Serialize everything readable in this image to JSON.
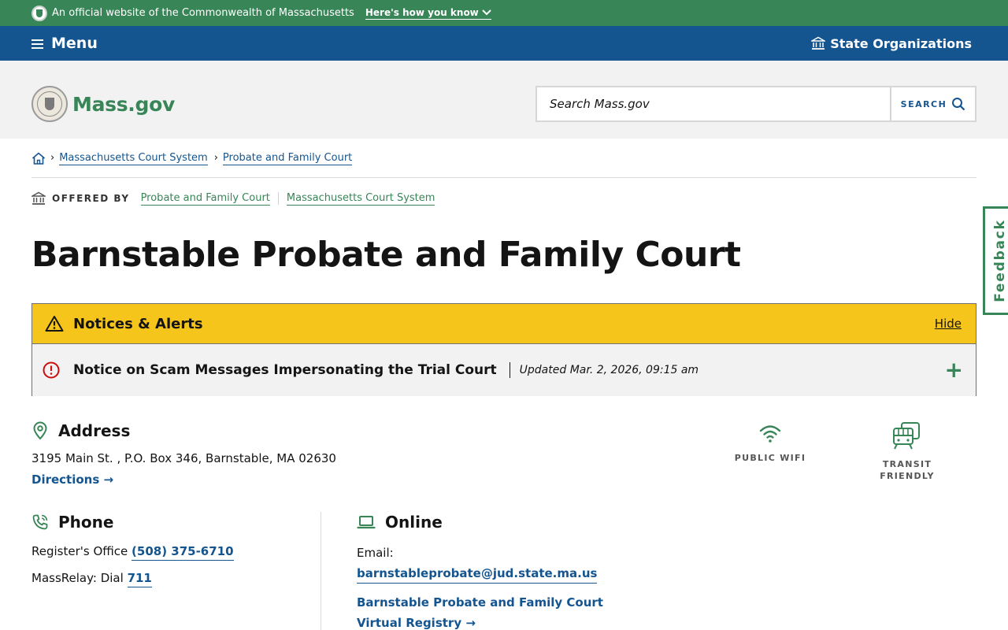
{
  "official_bar": {
    "text": "An official website of the Commonwealth of Massachusetts",
    "how_link": "Here's how you know"
  },
  "nav": {
    "menu_label": "Menu",
    "state_orgs_label": "State Organizations"
  },
  "header": {
    "logo_text": "Mass.gov",
    "search_placeholder": "Search Mass.gov",
    "search_button": "SEARCH"
  },
  "breadcrumb": {
    "items": [
      "Massachusetts Court System",
      "Probate and Family Court"
    ]
  },
  "offered_by": {
    "label": "OFFERED BY",
    "orgs": [
      "Probate and Family Court",
      "Massachusetts Court System"
    ]
  },
  "page_title": "Barnstable Probate and Family Court",
  "alerts": {
    "title": "Notices & Alerts",
    "hide_label": "Hide",
    "items": [
      {
        "title": "Notice on Scam Messages Impersonating the Trial Court",
        "updated": "Updated Mar. 2, 2026, 09:15 am",
        "expand_label": "+"
      }
    ]
  },
  "address": {
    "heading": "Address",
    "line": "3195 Main St. , P.O. Box 346, Barnstable, MA 02630",
    "directions": "Directions →"
  },
  "amenities": [
    {
      "label": "PUBLIC WIFI",
      "icon": "wifi-icon"
    },
    {
      "label": "TRANSIT FRIENDLY",
      "icon": "transit-icon"
    }
  ],
  "phone": {
    "heading": "Phone",
    "rows": [
      {
        "label": "Register's Office ",
        "value": "(508) 375-6710"
      },
      {
        "label": "MassRelay: Dial ",
        "value": "711"
      }
    ]
  },
  "online": {
    "heading": "Online",
    "email_label": "Email:",
    "email": "barnstableprobate@jud.state.ma.us",
    "registry_link": "Barnstable Probate and Family Court Virtual Registry →"
  },
  "feedback": "Feedback",
  "colors": {
    "green": "#388557",
    "blue": "#14558f",
    "alert_yellow": "#f6c51b",
    "alert_red": "#cd0d0d"
  }
}
